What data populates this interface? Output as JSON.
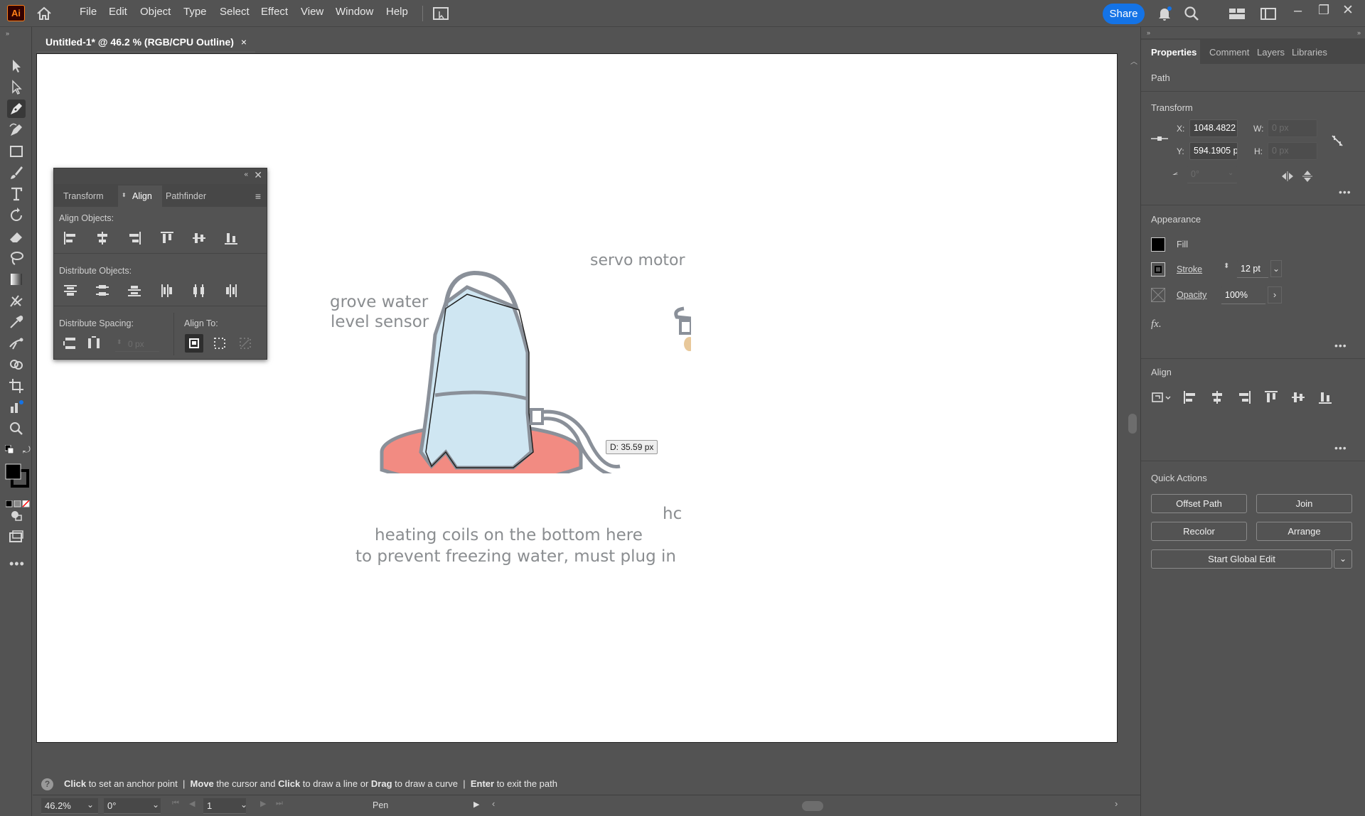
{
  "app": {
    "logo": "Ai"
  },
  "menu": [
    "File",
    "Edit",
    "Object",
    "Type",
    "Select",
    "Effect",
    "View",
    "Window",
    "Help"
  ],
  "header": {
    "share_label": "Share"
  },
  "document_tab": {
    "title": "Untitled-1* @ 46.2 % (RGB/CPU Outline)",
    "close": "×"
  },
  "align_panel": {
    "tabs": [
      "Transform",
      "Align",
      "Pathfinder"
    ],
    "active_tab": "Align",
    "align_objects_label": "Align Objects:",
    "distribute_objects_label": "Distribute Objects:",
    "distribute_spacing_label": "Distribute Spacing:",
    "align_to_label": "Align To:",
    "spacing_value": "0 px"
  },
  "artwork": {
    "labels": {
      "sensor_line1": "grove water",
      "sensor_line2": "level sensor",
      "servo": "servo motor",
      "heating_line1": "heating coils on the bottom here",
      "heating_line2": "to prevent freezing water, must plug in",
      "partial": "hc"
    },
    "distance_tooltip": "D: 35.59 px"
  },
  "right_panel": {
    "tabs": [
      "Properties",
      "Comment",
      "Layers",
      "Libraries"
    ],
    "active_tab": "Properties",
    "object_type": "Path",
    "transform": {
      "heading": "Transform",
      "x_label": "X:",
      "x_value": "1048.4822",
      "y_label": "Y:",
      "y_value": "594.1905 p",
      "w_label": "W:",
      "w_value": "0 px",
      "h_label": "H:",
      "h_value": "0 px",
      "angle_value": "0°"
    },
    "appearance": {
      "heading": "Appearance",
      "fill_label": "Fill",
      "stroke_label": "Stroke",
      "stroke_value": "12 pt",
      "opacity_label": "Opacity",
      "opacity_value": "100%",
      "fx_label": "fx."
    },
    "align": {
      "heading": "Align"
    },
    "quick_actions": {
      "heading": "Quick Actions",
      "offset_path": "Offset Path",
      "join": "Join",
      "recolor": "Recolor",
      "arrange": "Arrange",
      "start_global_edit": "Start Global Edit"
    }
  },
  "status": {
    "hint_parts": [
      "Click",
      " to set an anchor point  |  ",
      "Move",
      " the cursor and ",
      "Click",
      " to draw a line or ",
      "Drag",
      " to draw a curve  |  ",
      "Enter",
      " to exit the path"
    ],
    "zoom": "46.2%",
    "rotation": "0°",
    "artboard_number": "1",
    "current_tool": "Pen"
  },
  "colors": {
    "accent": "#1473e6",
    "heater": "#f28b82",
    "water": "#cfe6f2",
    "sketch": "#8a9099"
  }
}
